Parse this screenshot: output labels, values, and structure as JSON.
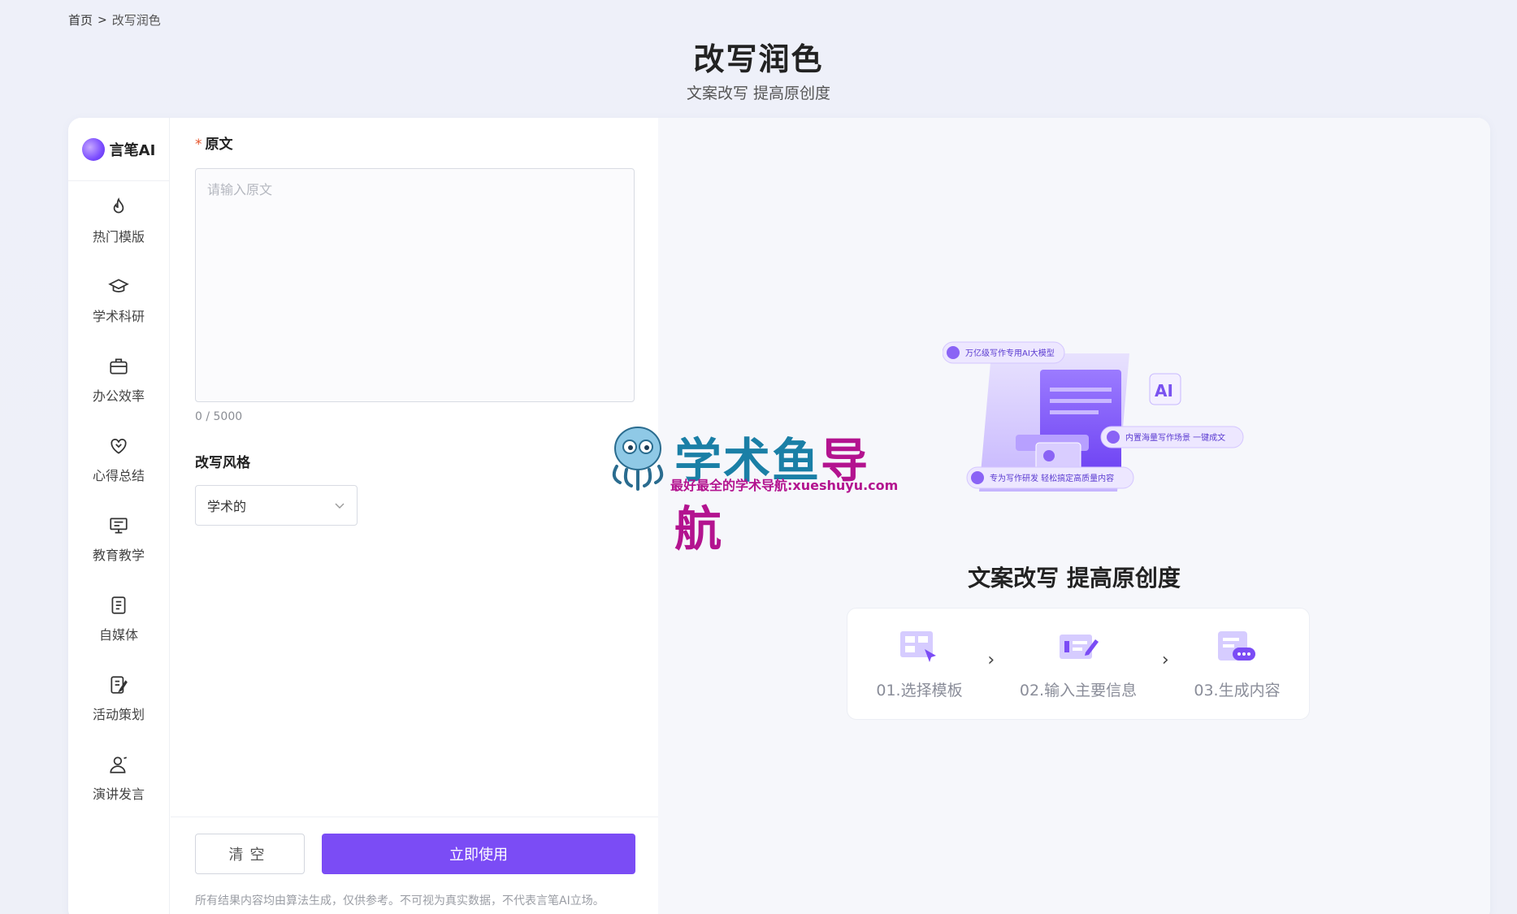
{
  "breadcrumb": {
    "home": "首页",
    "separator": ">",
    "current": "改写润色"
  },
  "header": {
    "title": "改写润色",
    "subtitle": "文案改写 提高原创度"
  },
  "brand": {
    "name": "言笔AI"
  },
  "sidebar": {
    "items": [
      {
        "label": "热门模版",
        "icon": "fire-icon"
      },
      {
        "label": "学术科研",
        "icon": "graduation-cap-icon"
      },
      {
        "label": "办公效率",
        "icon": "briefcase-icon"
      },
      {
        "label": "心得总结",
        "icon": "heart-icon"
      },
      {
        "label": "教育教学",
        "icon": "presentation-board-icon"
      },
      {
        "label": "自媒体",
        "icon": "document-icon"
      },
      {
        "label": "活动策划",
        "icon": "edit-document-icon"
      },
      {
        "label": "演讲发言",
        "icon": "speaker-icon"
      }
    ]
  },
  "form": {
    "original": {
      "required_mark": "*",
      "label": "原文",
      "placeholder": "请输入原文",
      "value": "",
      "counter": "0 / 5000"
    },
    "style": {
      "label": "改写风格",
      "selected": "学术的"
    },
    "buttons": {
      "clear": "清空",
      "submit": "立即使用"
    },
    "disclaimer": "所有结果内容均由算法生成，仅供参考。不可视为真实数据，不代表言笔AI立场。"
  },
  "preview": {
    "badges": [
      "万亿级写作专用AI大模型",
      "内置海量写作场景 一键成文",
      "专为写作研发 轻松搞定高质量内容"
    ],
    "ai_tag": "AI",
    "title": "文案改写 提高原创度",
    "steps": [
      {
        "label": "01.选择模板",
        "icon": "template-select-icon"
      },
      {
        "label": "02.输入主要信息",
        "icon": "input-info-icon"
      },
      {
        "label": "03.生成内容",
        "icon": "generate-content-icon"
      }
    ],
    "step_separator": "›"
  },
  "watermark": {
    "title_a": "学术鱼",
    "title_b": "导航",
    "subtitle": "最好最全的学术导航:xueshuyu.com"
  },
  "colors": {
    "accent": "#7b4cf5",
    "required": "#e6542b"
  }
}
